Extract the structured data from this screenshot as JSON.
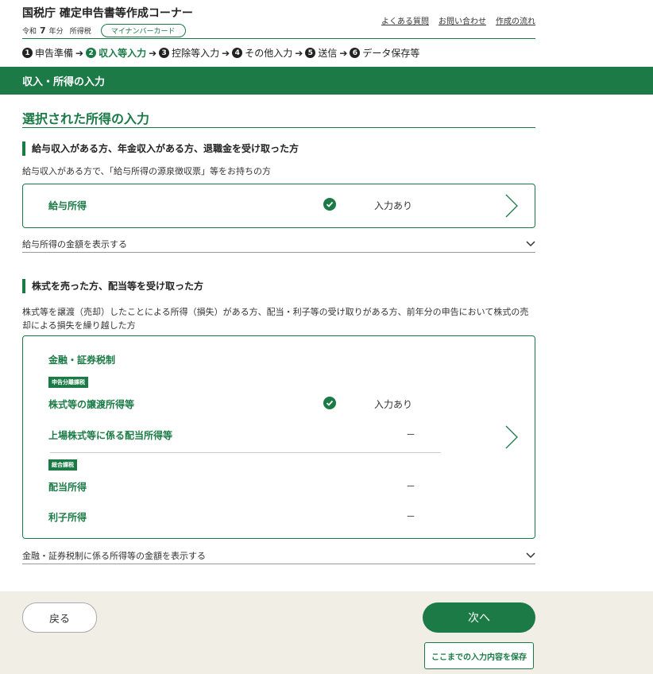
{
  "header": {
    "title": "国税庁 確定申告書等作成コーナー",
    "era": "令和",
    "year": "7",
    "year_suffix": "年分",
    "tax_type": "所得税",
    "auth_badge": "マイナンバーカード",
    "links": [
      "よくある質問",
      "お問い合わせ",
      "作成の流れ"
    ]
  },
  "steps": [
    {
      "num": "1",
      "label": "申告準備",
      "active": false
    },
    {
      "num": "2",
      "label": "収入等入力",
      "active": true
    },
    {
      "num": "3",
      "label": "控除等入力",
      "active": false
    },
    {
      "num": "4",
      "label": "その他入力",
      "active": false
    },
    {
      "num": "5",
      "label": "送信",
      "active": false
    },
    {
      "num": "6",
      "label": "データ保存等",
      "active": false
    }
  ],
  "step_arrow": "➔",
  "band_title": "収入・所得の入力",
  "section_title": "選択された所得の入力",
  "salary_section": {
    "heading": "給与収入がある方、年金収入がある方、退職金を受け取った方",
    "description": "給与収入がある方で、「給与所得の源泉徴収票」等をお持ちの方",
    "card": {
      "label": "給与所得",
      "status": "入力あり"
    },
    "toggle": "給与所得の金額を表示する"
  },
  "stock_section": {
    "heading": "株式を売った方、配当等を受け取った方",
    "description": "株式等を譲渡（売却）したことによる所得（損失）がある方、配当・利子等の受け取りがある方、前年分の申告において株式の売却による損失を繰り越した方",
    "card": {
      "title": "金融・証券税制",
      "tag1": "申告分離課税",
      "row1": {
        "label": "株式等の譲渡所得等",
        "status": "入力あり"
      },
      "row2": {
        "label": "上場株式等に係る配当所得等",
        "status": "－"
      },
      "tag2": "総合課税",
      "row3": {
        "label": "配当所得",
        "status": "－"
      },
      "row4": {
        "label": "利子所得",
        "status": "－"
      }
    },
    "toggle": "金融・証券税制に係る所得等の金額を表示する"
  },
  "footer": {
    "back": "戻る",
    "next": "次へ",
    "save": "ここまでの入力内容を保存"
  },
  "colors": {
    "accent": "#1b7a46",
    "footer_bg": "#f1efe5"
  }
}
